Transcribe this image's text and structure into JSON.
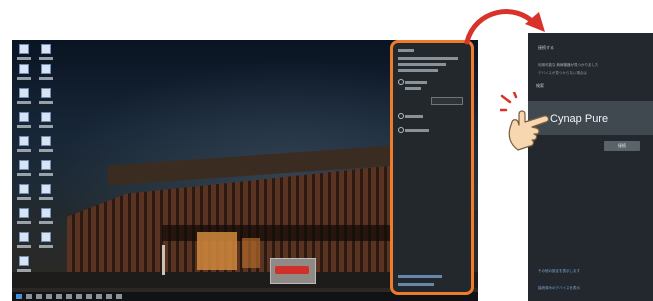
{
  "zoom_panel": {
    "title": "接続する",
    "desc1": "利用可能な 無線機器が見つかりました",
    "desc2": "デバイスが見つからない場合は",
    "search_label": "検索",
    "device_name": "Cynap Pure",
    "connect_button": "接続",
    "link1": "その他の設定を表示します",
    "link2": "接続済みのデバイスを表示"
  },
  "colors": {
    "highlight": "#ef7b2c",
    "arrow": "#d9322a",
    "panel_bg": "#22282d",
    "selected_row": "#404950"
  }
}
